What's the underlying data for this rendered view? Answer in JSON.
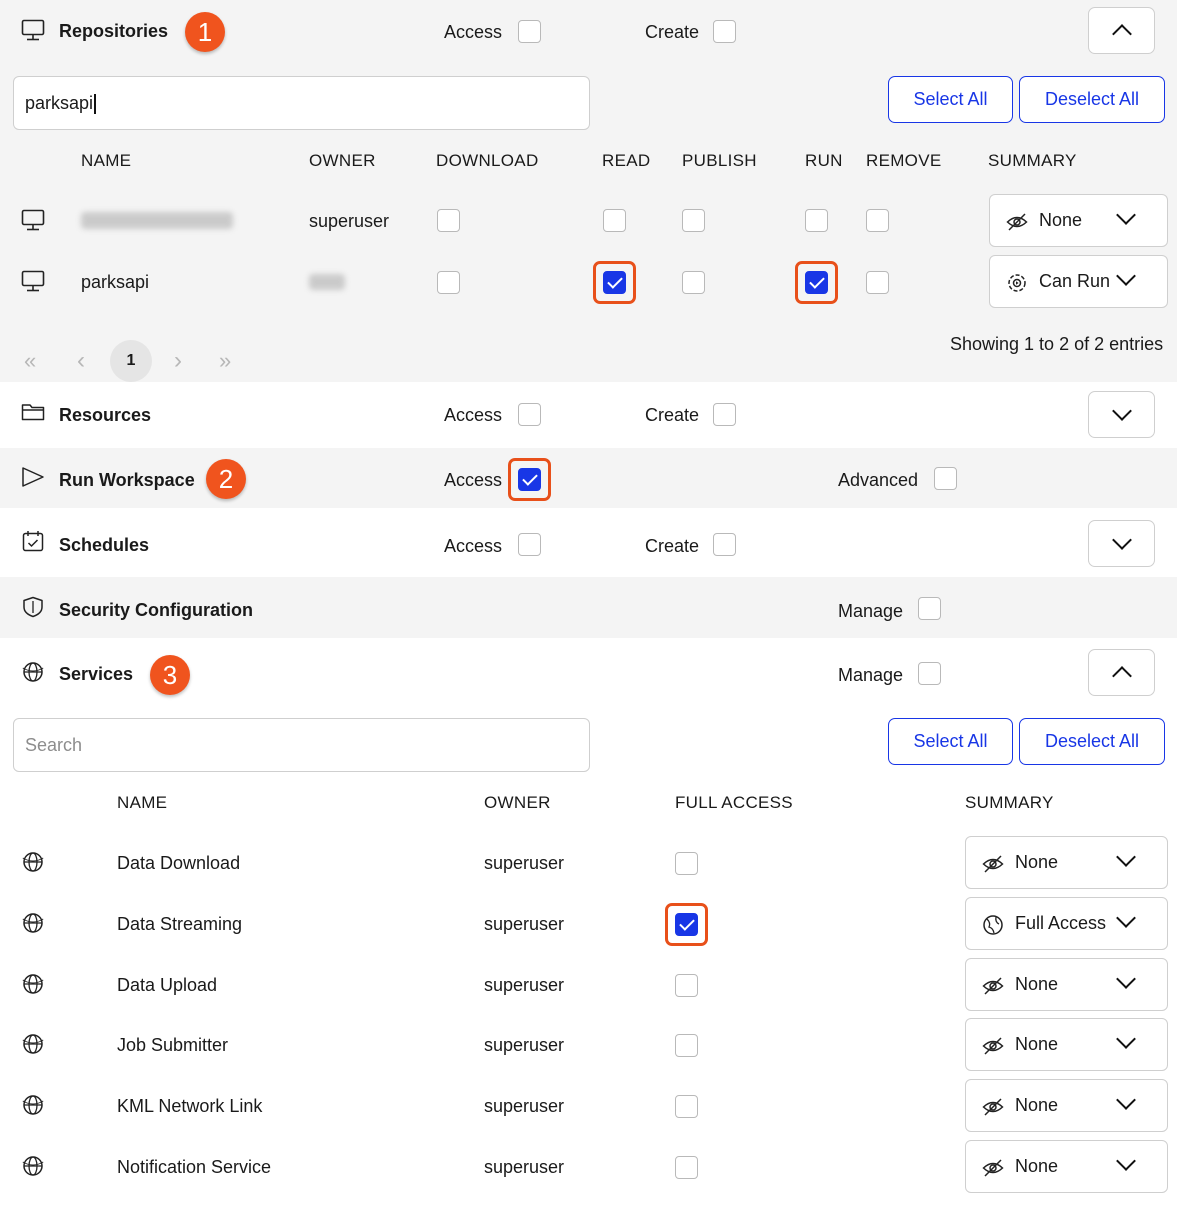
{
  "repositories": {
    "title": "Repositories",
    "badge": "1",
    "access_label": "Access",
    "create_label": "Create",
    "search_value": "parksapi",
    "select_all": "Select All",
    "deselect_all": "Deselect All",
    "columns": [
      "NAME",
      "OWNER",
      "DOWNLOAD",
      "READ",
      "PUBLISH",
      "RUN",
      "REMOVE",
      "SUMMARY"
    ],
    "rows": [
      {
        "name": "",
        "owner": "superuser",
        "download": false,
        "read": false,
        "publish": false,
        "run": false,
        "remove": false,
        "summary": "None",
        "summary_icon": "eye-slash-icon"
      },
      {
        "name": "parksapi",
        "owner": "",
        "download": false,
        "read": true,
        "publish": false,
        "run": true,
        "remove": false,
        "summary": "Can Run",
        "summary_icon": "run-gear-icon"
      }
    ],
    "pagination": {
      "current": "1",
      "first": "«",
      "prev": "‹",
      "next": "›",
      "last": "»"
    },
    "entries_text": "Showing 1 to 2 of 2 entries"
  },
  "resources": {
    "title": "Resources",
    "access_label": "Access",
    "create_label": "Create"
  },
  "run_workspace": {
    "title": "Run Workspace",
    "badge": "2",
    "access_label": "Access",
    "access_checked": true,
    "advanced_label": "Advanced"
  },
  "schedules": {
    "title": "Schedules",
    "access_label": "Access",
    "create_label": "Create"
  },
  "security": {
    "title": "Security Configuration",
    "manage_label": "Manage"
  },
  "services": {
    "title": "Services",
    "badge": "3",
    "manage_label": "Manage",
    "search_placeholder": "Search",
    "select_all": "Select All",
    "deselect_all": "Deselect All",
    "columns": [
      "NAME",
      "OWNER",
      "FULL ACCESS",
      "SUMMARY"
    ],
    "rows": [
      {
        "name": "Data Download",
        "owner": "superuser",
        "full_access": false,
        "summary": "None",
        "summary_icon": "eye-slash-icon"
      },
      {
        "name": "Data Streaming",
        "owner": "superuser",
        "full_access": true,
        "summary": "Full Access",
        "summary_icon": "globe-access-icon"
      },
      {
        "name": "Data Upload",
        "owner": "superuser",
        "full_access": false,
        "summary": "None",
        "summary_icon": "eye-slash-icon"
      },
      {
        "name": "Job Submitter",
        "owner": "superuser",
        "full_access": false,
        "summary": "None",
        "summary_icon": "eye-slash-icon"
      },
      {
        "name": "KML Network Link",
        "owner": "superuser",
        "full_access": false,
        "summary": "None",
        "summary_icon": "eye-slash-icon"
      },
      {
        "name": "Notification Service",
        "owner": "superuser",
        "full_access": false,
        "summary": "None",
        "summary_icon": "eye-slash-icon"
      }
    ]
  },
  "colors": {
    "accent": "#1836e6",
    "highlight": "#e8501a",
    "badge": "#f0541e",
    "band": "#f4f4f4"
  }
}
